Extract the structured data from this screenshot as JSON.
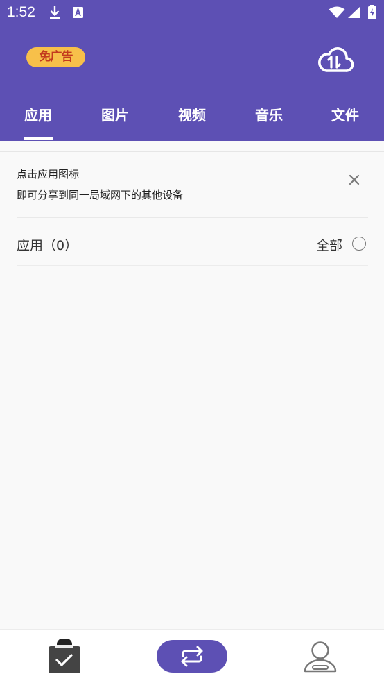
{
  "status_bar": {
    "time": "1:52",
    "icons": [
      "download-icon",
      "font-a-icon",
      "wifi-icon",
      "cell-signal-icon",
      "battery-charging-icon"
    ]
  },
  "header": {
    "noads_badge": "免广告",
    "cloud_icon": "cloud-transfer-icon",
    "accent_color": "#5d50b4"
  },
  "tabs": [
    {
      "label": "应用",
      "selected": true
    },
    {
      "label": "图片",
      "selected": false
    },
    {
      "label": "视频",
      "selected": false
    },
    {
      "label": "音乐",
      "selected": false
    },
    {
      "label": "文件",
      "selected": false
    }
  ],
  "tip": {
    "line1": "点击应用图标",
    "line2": "即可分享到同一局域网下的其他设备",
    "close_icon": "close-icon"
  },
  "section": {
    "title": "应用（0）",
    "select_all_label": "全部",
    "select_all_checked": false
  },
  "bottom_nav": [
    {
      "icon": "clipboard-check-icon",
      "active": false
    },
    {
      "icon": "transfer-arrows-icon",
      "active": true
    },
    {
      "icon": "user-profile-icon",
      "active": false
    }
  ]
}
